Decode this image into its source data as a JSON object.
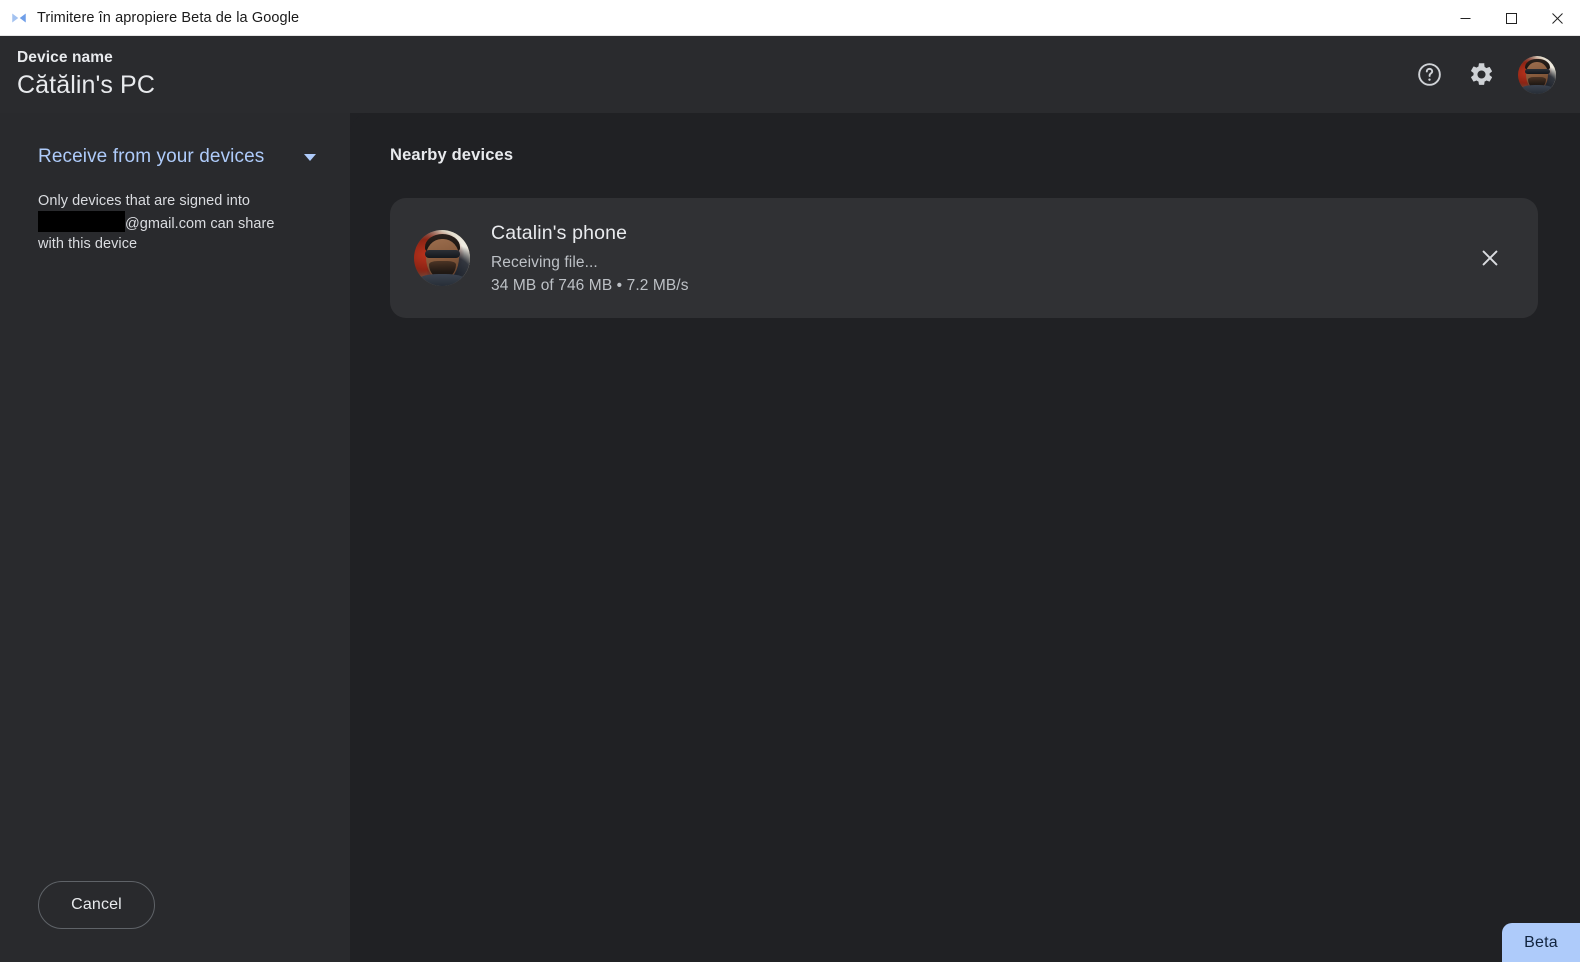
{
  "window": {
    "title": "Trimitere în apropiere Beta de la Google",
    "app_icon": "nearby-share-icon",
    "controls": {
      "minimize": "minimize-icon",
      "maximize": "maximize-icon",
      "close": "close-icon"
    }
  },
  "header": {
    "device_label": "Device name",
    "device_name": "Cătălin's PC",
    "help_icon": "help-icon",
    "settings_icon": "gear-icon",
    "avatar": "user-avatar"
  },
  "sidebar": {
    "visibility_mode": "Receive from your devices",
    "caret_icon": "chevron-down-icon",
    "description_prefix": "Only devices that are signed into",
    "description_redacted": "",
    "description_suffix": "@gmail.com can share with this device",
    "cancel_label": "Cancel"
  },
  "main": {
    "section_title": "Nearby devices",
    "device": {
      "name": "Catalin's phone",
      "status": "Receiving file...",
      "progress": "34 MB of 746 MB • 7.2 MB/s",
      "transferred": "34 MB",
      "total": "746 MB",
      "speed": "7.2 MB/s",
      "avatar": "contact-avatar",
      "close_icon": "close-icon"
    }
  },
  "beta_badge": {
    "label": "Beta"
  },
  "colors": {
    "accent": "#aecbfa",
    "titlebar_bg": "#ffffff",
    "header_bg": "#2a2b2e",
    "sidebar_bg": "#292a2d",
    "panel_bg": "#202124",
    "card_bg": "#303134",
    "text_primary": "#e8eaed",
    "text_secondary": "#bdc1c6",
    "badge_text": "#11243f"
  }
}
